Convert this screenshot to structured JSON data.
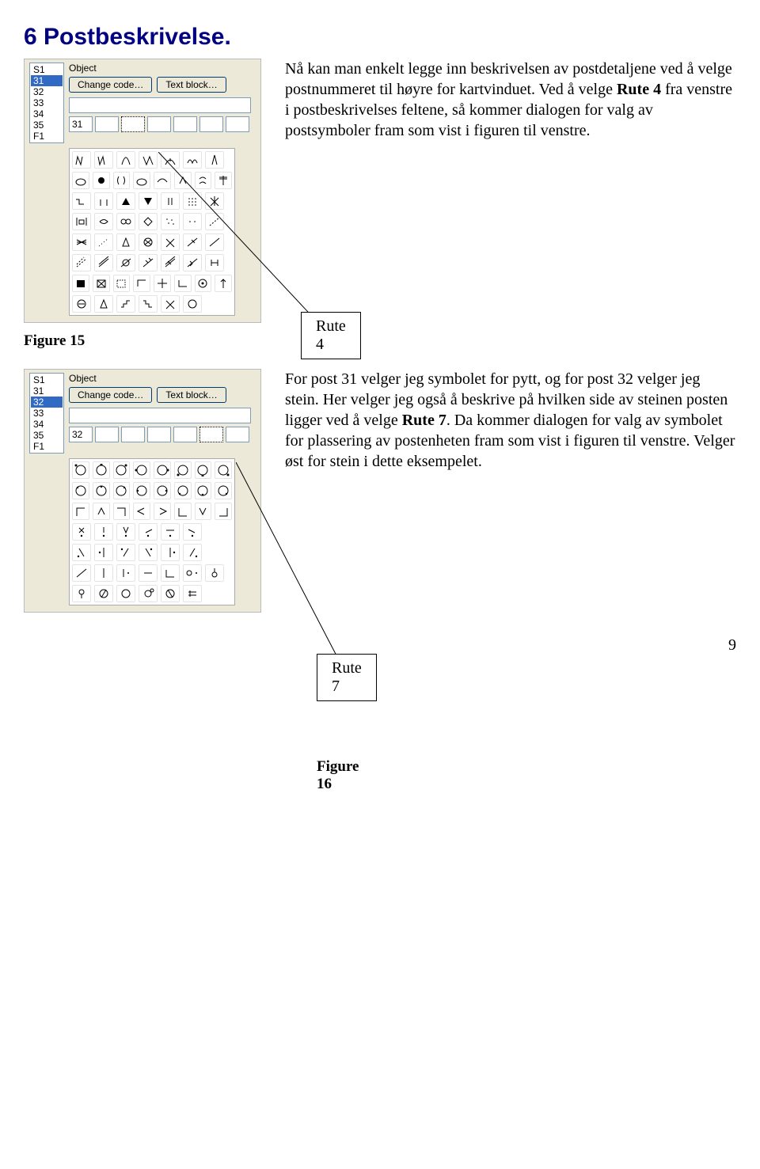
{
  "heading": "6  Postbeskrivelse.",
  "para1_a": "Nå kan man enkelt legge inn beskrivelsen av postdetaljene ved å velge postnummeret til høyre for kartvinduet. Ved å velge ",
  "para1_b": " fra venstre i postbeskrivelses feltene, så kommer dialogen for valg av postsymboler fram som vist i figuren til venstre.",
  "bold_rute4": "Rute 4",
  "callout_rute4": "Rute 4",
  "figure15_label": "Figure 15",
  "para2_a": "For post 31 velger jeg symbolet for pytt, og for post 32 velger jeg stein. Her velger jeg også å beskrive på hvilken side av steinen posten ligger ved å velge ",
  "bold_rute7": "Rute 7",
  "para2_b": ". Da kommer dialogen for valg av symbolet for plassering av postenheten fram som vist i figuren til venstre. Velger øst for stein i dette eksempelet.",
  "callout_rute7": "Rute 7",
  "figure16_label": "Figure 16",
  "page_num": "9",
  "panel1": {
    "posts": [
      "S1",
      "31",
      "32",
      "33",
      "34",
      "35",
      "F1"
    ],
    "selected": 1,
    "object_label": "Object",
    "change_code": "Change code…",
    "text_block": "Text block…",
    "fields": [
      "",
      "31",
      "",
      "",
      "",
      "",
      "",
      ""
    ]
  },
  "panel2": {
    "posts": [
      "S1",
      "31",
      "32",
      "33",
      "34",
      "35",
      "F1"
    ],
    "selected": 2,
    "object_label": "Object",
    "change_code": "Change code…",
    "text_block": "Text block…",
    "fields": [
      "",
      "32",
      "",
      "",
      "",
      "",
      "",
      ""
    ]
  }
}
